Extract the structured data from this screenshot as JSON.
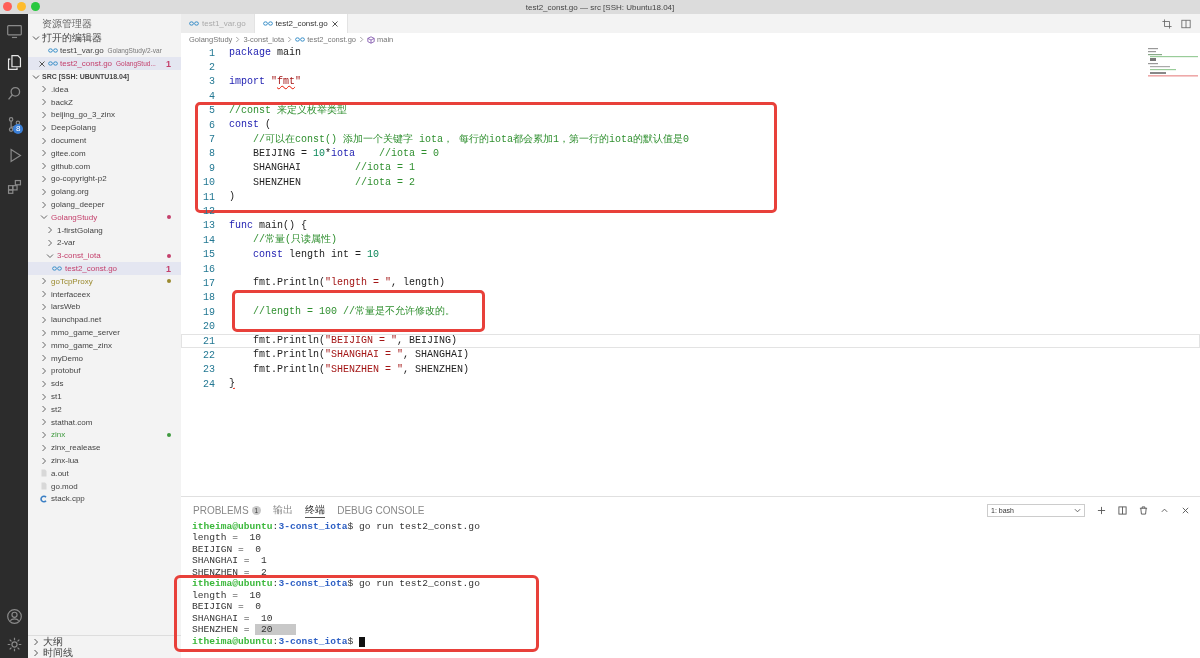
{
  "window": {
    "title": "test2_const.go — src [SSH: Ubuntu18.04]"
  },
  "activity_bar": {
    "items": [
      {
        "kind": "remote",
        "selected": false
      },
      {
        "kind": "files",
        "selected": true
      },
      {
        "kind": "search",
        "selected": false
      },
      {
        "kind": "scm",
        "selected": false,
        "badge": "8"
      },
      {
        "kind": "debug",
        "selected": false
      },
      {
        "kind": "extensions",
        "selected": false
      }
    ],
    "bottom_items": [
      {
        "kind": "account",
        "selected": false
      },
      {
        "kind": "settings",
        "selected": false
      }
    ]
  },
  "explorer": {
    "title": "资源管理器",
    "open_editors_title": "打开的编辑器",
    "open_editors": [
      {
        "label": "test1_var.go",
        "description": "GolangStudy/2-var",
        "kind": "go",
        "selected": false
      },
      {
        "label": "test2_const.go",
        "description": "GolangStud...",
        "kind": "go",
        "selected": true,
        "badge": "1",
        "color": "#c4406c"
      }
    ],
    "root_title": "SRC [SSH: UBUNTU18.04]",
    "root_expanded": true,
    "tree": [
      {
        "label": ".idea",
        "kind": "folder",
        "expanded": false,
        "selected": false
      },
      {
        "label": "backZ",
        "kind": "folder",
        "expanded": false,
        "selected": false
      },
      {
        "label": "beijing_go_3_zinx",
        "kind": "folder",
        "expanded": false,
        "selected": false
      },
      {
        "label": "DeepGolang",
        "kind": "folder",
        "expanded": false,
        "selected": false
      },
      {
        "label": "document",
        "kind": "folder",
        "expanded": false,
        "selected": false
      },
      {
        "label": "gitee.com",
        "kind": "folder",
        "expanded": false,
        "selected": false
      },
      {
        "label": "github.com",
        "kind": "folder",
        "expanded": false,
        "selected": false
      },
      {
        "label": "go-copyright-p2",
        "kind": "folder",
        "expanded": false,
        "selected": false
      },
      {
        "label": "golang.org",
        "kind": "folder",
        "expanded": false,
        "selected": false
      },
      {
        "label": "golang_deeper",
        "kind": "folder",
        "expanded": false,
        "selected": false
      },
      {
        "label": "GolangStudy",
        "kind": "folder",
        "expanded": true,
        "selected": false,
        "color": "#c4406c",
        "children": [
          {
            "label": "1-firstGolang",
            "kind": "folder",
            "expanded": false,
            "selected": false
          },
          {
            "label": "2-var",
            "kind": "folder",
            "expanded": false,
            "selected": false
          },
          {
            "label": "3-const_iota",
            "kind": "folder",
            "expanded": true,
            "selected": false,
            "color": "#c4406c",
            "children": [
              {
                "label": "test2_const.go",
                "kind": "go",
                "selected": true,
                "color": "#c4406c",
                "badge": "1"
              }
            ]
          }
        ]
      },
      {
        "label": "goTcpProxy",
        "kind": "folder",
        "expanded": false,
        "selected": false,
        "color": "#9b8a2e"
      },
      {
        "label": "interfaceex",
        "kind": "folder",
        "expanded": false,
        "selected": false
      },
      {
        "label": "larsWeb",
        "kind": "folder",
        "expanded": false,
        "selected": false
      },
      {
        "label": "launchpad.net",
        "kind": "folder",
        "expanded": false,
        "selected": false
      },
      {
        "label": "mmo_game_server",
        "kind": "folder",
        "expanded": false,
        "selected": false
      },
      {
        "label": "mmo_game_zinx",
        "kind": "folder",
        "expanded": false,
        "selected": false
      },
      {
        "label": "myDemo",
        "kind": "folder",
        "expanded": false,
        "selected": false
      },
      {
        "label": "protobuf",
        "kind": "folder",
        "expanded": false,
        "selected": false
      },
      {
        "label": "sds",
        "kind": "folder",
        "expanded": false,
        "selected": false
      },
      {
        "label": "st1",
        "kind": "folder",
        "expanded": false,
        "selected": false
      },
      {
        "label": "st2",
        "kind": "folder",
        "expanded": false,
        "selected": false
      },
      {
        "label": "stathat.com",
        "kind": "folder",
        "expanded": false,
        "selected": false
      },
      {
        "label": "zinx",
        "kind": "folder",
        "expanded": false,
        "selected": false,
        "color": "#3f9a3f"
      },
      {
        "label": "zinx_realease",
        "kind": "folder",
        "expanded": false,
        "selected": false
      },
      {
        "label": "zinx-lua",
        "kind": "folder",
        "expanded": false,
        "selected": false
      },
      {
        "label": "a.out",
        "kind": "file",
        "selected": false
      },
      {
        "label": "go.mod",
        "kind": "file",
        "selected": false
      },
      {
        "label": "stack.cpp",
        "kind": "cpp",
        "selected": false
      }
    ],
    "sections": [
      {
        "label": "大纲",
        "expanded": false
      },
      {
        "label": "时间线",
        "expanded": false
      }
    ]
  },
  "tabs": [
    {
      "label": "test1_var.go",
      "selected": false
    },
    {
      "label": "test2_const.go",
      "selected": true
    }
  ],
  "breadcrumb": [
    {
      "label": "GolangStudy",
      "kind": "folder"
    },
    {
      "label": "3-const_iota",
      "kind": "folder"
    },
    {
      "label": "test2_const.go",
      "kind": "go"
    },
    {
      "label": "main",
      "kind": "method"
    }
  ],
  "code": {
    "blocks": [
      {
        "highlighted": false,
        "lines": [
          {
            "number": "1",
            "active": false,
            "tokens": [
              {
                "kind": "keyword",
                "text": "package"
              },
              {
                "kind": "plain",
                "text": " main"
              }
            ]
          },
          {
            "number": "2",
            "active": false
          },
          {
            "number": "3",
            "active": false,
            "tokens": [
              {
                "kind": "keyword",
                "text": "import "
              },
              {
                "kind": "string",
                "text": "\""
              },
              {
                "kind": "string_error",
                "text": "fmt"
              },
              {
                "kind": "string",
                "text": "\""
              }
            ]
          },
          {
            "number": "4",
            "active": false
          }
        ]
      },
      {
        "highlighted": true,
        "lines": [
          {
            "number": "5",
            "active": false,
            "tokens": [
              {
                "kind": "comment",
                "text": "//const 来定义枚举类型"
              }
            ]
          },
          {
            "number": "6",
            "active": false,
            "tokens": [
              {
                "kind": "keyword",
                "text": "const"
              },
              {
                "kind": "plain",
                "text": " ("
              }
            ]
          },
          {
            "number": "7",
            "active": false,
            "tokens": [
              {
                "kind": "comment",
                "text": "    //可以在const() 添加一个关键字 iota， 每行的iota都会累加1，第一行的iota的默认值是0"
              }
            ]
          },
          {
            "number": "8",
            "active": false,
            "tokens": [
              {
                "kind": "plain",
                "text": "    BEIJING = "
              },
              {
                "kind": "number",
                "text": "10"
              },
              {
                "kind": "plain",
                "text": "*"
              },
              {
                "kind": "keyword",
                "text": "iota"
              },
              {
                "kind": "comment",
                "text": "    //iota = 0"
              }
            ]
          },
          {
            "number": "9",
            "active": false,
            "tokens": [
              {
                "kind": "plain",
                "text": "    SHANGHAI         "
              },
              {
                "kind": "comment",
                "text": "//iota = 1"
              }
            ]
          },
          {
            "number": "10",
            "active": false,
            "tokens": [
              {
                "kind": "plain",
                "text": "    SHENZHEN         "
              },
              {
                "kind": "comment",
                "text": "//iota = 2"
              }
            ]
          },
          {
            "number": "11",
            "active": false,
            "tokens": [
              {
                "kind": "plain",
                "text": ")"
              }
            ]
          }
        ]
      },
      {
        "highlighted": false,
        "lines": [
          {
            "number": "12",
            "active": false
          },
          {
            "number": "13",
            "active": false,
            "tokens": [
              {
                "kind": "keyword",
                "text": "func"
              },
              {
                "kind": "plain",
                "text": " main() {"
              }
            ]
          },
          {
            "number": "14",
            "active": false,
            "tokens": [
              {
                "kind": "comment",
                "text": "    //常量(只读属性)"
              }
            ]
          },
          {
            "number": "15",
            "active": false,
            "tokens": [
              {
                "kind": "keyword",
                "text": "    const"
              },
              {
                "kind": "plain",
                "text": " length int = "
              },
              {
                "kind": "number",
                "text": "10"
              }
            ]
          },
          {
            "number": "16",
            "active": false
          },
          {
            "number": "17",
            "active": false,
            "tokens": [
              {
                "kind": "plain",
                "text": "    fmt.Println("
              },
              {
                "kind": "string",
                "text": "\"length = \""
              },
              {
                "kind": "plain",
                "text": ", length)"
              }
            ]
          }
        ]
      },
      {
        "highlighted": true,
        "lines": [
          {
            "number": "18",
            "active": false
          },
          {
            "number": "19",
            "active": false,
            "tokens": [
              {
                "kind": "comment",
                "text": "    //length = 100 //常量是不允许修改的。"
              }
            ]
          },
          {
            "number": "20",
            "active": false
          }
        ]
      },
      {
        "highlighted": false,
        "lines": [
          {
            "number": "21",
            "active": true,
            "tokens": [
              {
                "kind": "plain",
                "text": "    fmt.Println("
              },
              {
                "kind": "string",
                "text": "\"BEIJIGN = \""
              },
              {
                "kind": "plain",
                "text": ", BEIJING)"
              }
            ]
          },
          {
            "number": "22",
            "active": false,
            "tokens": [
              {
                "kind": "plain",
                "text": "    fmt.Println("
              },
              {
                "kind": "string",
                "text": "\"SHANGHAI = \""
              },
              {
                "kind": "plain",
                "text": ", SHANGHAI)"
              }
            ]
          },
          {
            "number": "23",
            "active": false,
            "tokens": [
              {
                "kind": "plain",
                "text": "    fmt.Println("
              },
              {
                "kind": "string",
                "text": "\"SHENZHEN = \""
              },
              {
                "kind": "plain",
                "text": ", SHENZHEN)"
              }
            ]
          },
          {
            "number": "24",
            "active": false,
            "tokens": [
              {
                "kind": "plain_error",
                "text": "}"
              }
            ]
          }
        ]
      }
    ]
  },
  "panel": {
    "tabs": [
      {
        "label": "PROBLEMS",
        "badge": "1",
        "selected": false
      },
      {
        "label": "输出",
        "selected": false
      },
      {
        "label": "终端",
        "selected": true
      },
      {
        "label": "DEBUG CONSOLE",
        "selected": false
      }
    ],
    "terminal_select": "1: bash"
  },
  "terminal": {
    "blocks": [
      {
        "highlighted": false,
        "lines": [
          {
            "cursor": false,
            "tokens": [
              {
                "kind": "user",
                "text": "itheima@ubuntu"
              },
              {
                "kind": "plain",
                "text": ":"
              },
              {
                "kind": "path",
                "text": "3-const_iota"
              },
              {
                "kind": "plain",
                "text": "$ go run test2_const.go"
              }
            ]
          },
          {
            "cursor": false,
            "tokens": [
              {
                "kind": "plain",
                "text": "length =  10"
              }
            ]
          },
          {
            "cursor": false,
            "tokens": [
              {
                "kind": "plain",
                "text": "BEIJIGN =  0"
              }
            ]
          },
          {
            "cursor": false,
            "tokens": [
              {
                "kind": "plain",
                "text": "SHANGHAI =  1"
              }
            ]
          },
          {
            "cursor": false,
            "tokens": [
              {
                "kind": "plain",
                "text": "SHENZHEN =  2"
              }
            ]
          }
        ]
      },
      {
        "highlighted": true,
        "lines": [
          {
            "cursor": false,
            "tokens": [
              {
                "kind": "user",
                "text": "itheima@ubuntu"
              },
              {
                "kind": "plain",
                "text": ":"
              },
              {
                "kind": "path",
                "text": "3-const_iota"
              },
              {
                "kind": "plain",
                "text": "$ go run test2_const.go"
              }
            ]
          },
          {
            "cursor": false,
            "tokens": [
              {
                "kind": "plain",
                "text": "length =  10"
              }
            ]
          },
          {
            "cursor": false,
            "tokens": [
              {
                "kind": "plain",
                "text": "BEIJIGN =  0"
              }
            ]
          },
          {
            "cursor": false,
            "tokens": [
              {
                "kind": "plain",
                "text": "SHANGHAI =  10"
              }
            ]
          },
          {
            "cursor": false,
            "tokens": [
              {
                "kind": "plain",
                "text": "SHENZHEN = "
              },
              {
                "kind": "selected",
                "text": " 20    "
              }
            ]
          },
          {
            "cursor": true,
            "tokens": [
              {
                "kind": "user",
                "text": "itheima@ubuntu"
              },
              {
                "kind": "plain",
                "text": ":"
              },
              {
                "kind": "path",
                "text": "3-const_iota"
              },
              {
                "kind": "plain",
                "text": "$ "
              }
            ]
          }
        ]
      }
    ]
  }
}
